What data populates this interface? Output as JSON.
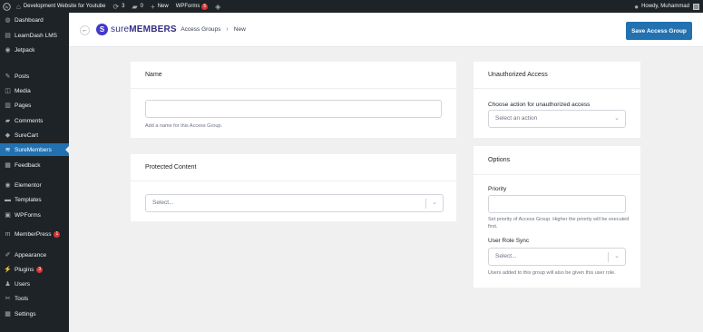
{
  "admin_bar": {
    "site_title": "Development Website for Youtube",
    "updates_count": "3",
    "comments_count": "0",
    "new_label": "New",
    "wpforms_label": "WPForms",
    "wpforms_badge": "5",
    "howdy": "Howdy, Muhammad"
  },
  "sidebar": {
    "items": [
      {
        "label": "Dashboard",
        "icon": "dashboard-icon"
      },
      {
        "label": "LearnDash LMS",
        "icon": "learndash-icon"
      },
      {
        "label": "Jetpack",
        "icon": "jetpack-icon"
      },
      {
        "label": "Posts",
        "icon": "pin-icon"
      },
      {
        "label": "Media",
        "icon": "media-icon"
      },
      {
        "label": "Pages",
        "icon": "pages-icon"
      },
      {
        "label": "Comments",
        "icon": "comment-icon"
      },
      {
        "label": "SureCart",
        "icon": "surecart-icon"
      },
      {
        "label": "SureMembers",
        "icon": "suremembers-icon"
      },
      {
        "label": "Feedback",
        "icon": "feedback-icon"
      },
      {
        "label": "Elementor",
        "icon": "elementor-icon"
      },
      {
        "label": "Templates",
        "icon": "folder-icon"
      },
      {
        "label": "WPForms",
        "icon": "wpforms-icon"
      },
      {
        "label": "MemberPress",
        "icon": "memberpress-icon",
        "badge": "1"
      },
      {
        "label": "Appearance",
        "icon": "brush-icon"
      },
      {
        "label": "Plugins",
        "icon": "plug-icon",
        "badge": "3"
      },
      {
        "label": "Users",
        "icon": "user-icon"
      },
      {
        "label": "Tools",
        "icon": "wrench-icon"
      },
      {
        "label": "Settings",
        "icon": "settings-icon"
      }
    ],
    "active": "SureMembers"
  },
  "header": {
    "logo_text_light": "sure",
    "logo_text_bold": "MEMBERS",
    "breadcrumb": [
      "Access Groups",
      "New"
    ],
    "save_label": "Save Access Group"
  },
  "name_card": {
    "title": "Name",
    "input_value": "",
    "help": "Add a name for this Access Group."
  },
  "protected_card": {
    "title": "Protected Content",
    "select_placeholder": "Select..."
  },
  "unauthorized_card": {
    "title": "Unauthorized Access",
    "field_label": "Choose action for unauthorized access",
    "select_placeholder": "Select an action"
  },
  "options_card": {
    "title": "Options",
    "priority_label": "Priority",
    "priority_value": "",
    "priority_help": "Set priority of Access Group. Higher the priority will be executed first.",
    "role_sync_label": "User Role Sync",
    "role_sync_placeholder": "Select...",
    "role_sync_help": "Users added to this group will also be given this user role."
  },
  "colors": {
    "admin_dark": "#1d2327",
    "accent_blue": "#2271b1",
    "background": "#f0f0f1",
    "badge_red": "#d63638",
    "brand_indigo": "#4338ca"
  }
}
